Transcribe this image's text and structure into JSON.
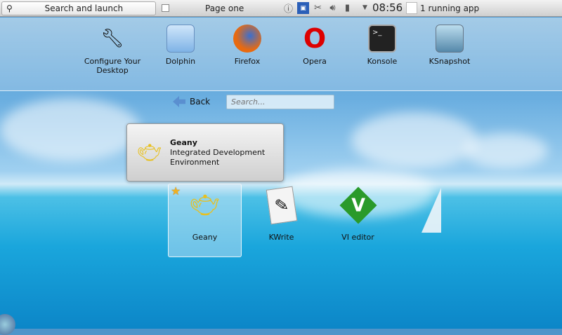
{
  "topbar": {
    "search_launch": "Search and launch",
    "page": "Page one",
    "clock": "08:56",
    "running": "1 running app",
    "tray_icons": [
      "info-icon",
      "network-icon",
      "klipper-icon",
      "volume-icon",
      "battery-icon"
    ]
  },
  "favorites": [
    {
      "label": "Configure Your Desktop",
      "icon": "tools-icon"
    },
    {
      "label": "Dolphin",
      "icon": "folder-icon"
    },
    {
      "label": "Firefox",
      "icon": "firefox-icon"
    },
    {
      "label": "Opera",
      "icon": "opera-icon"
    },
    {
      "label": "Konsole",
      "icon": "terminal-icon"
    },
    {
      "label": "KSnapshot",
      "icon": "camera-icon"
    }
  ],
  "nav": {
    "back": "Back",
    "search_placeholder": "Search..."
  },
  "tooltip": {
    "title": "Geany",
    "desc1": "Integrated Development",
    "desc2": "Environment"
  },
  "results": [
    {
      "label": "Geany",
      "icon": "teapot-icon"
    },
    {
      "label": "KWrite",
      "icon": "text-editor-icon"
    },
    {
      "label": "VI editor",
      "icon": "vim-icon"
    }
  ]
}
